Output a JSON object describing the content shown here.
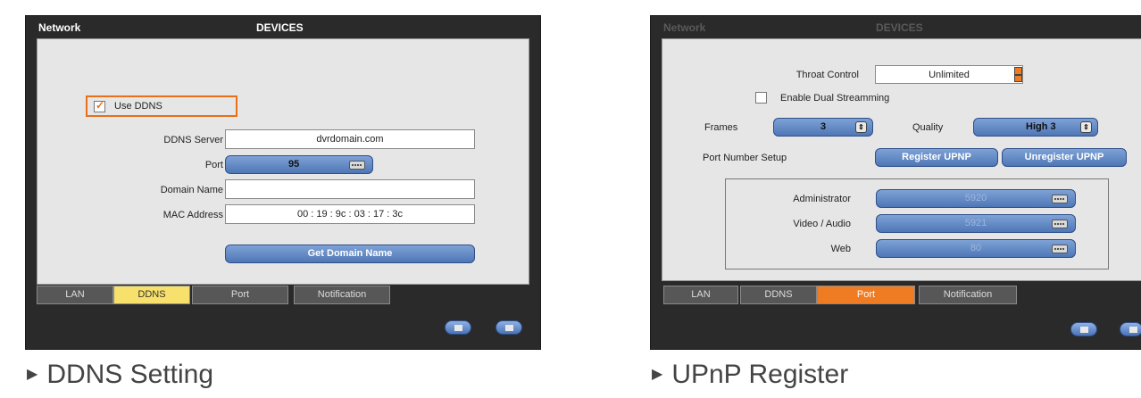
{
  "ddns_screen": {
    "menu": "Network",
    "page_title": "DEVICES",
    "use_ddns_label": "Use DDNS",
    "use_ddns_checked": true,
    "fields": {
      "server_label": "DDNS Server",
      "server_value": "dvrdomain.com",
      "port_label": "Port",
      "port_value": "95",
      "domain_label": "Domain Name",
      "domain_value": "",
      "mac_label": "MAC Address",
      "mac_value": "00 : 19 : 9c : 03 : 17 : 3c"
    },
    "get_domain_button": "Get Domain Name",
    "tabs": [
      "LAN",
      "DDNS",
      "Port",
      "Notification"
    ],
    "active_tab": "DDNS",
    "caption": "DDNS Setting"
  },
  "upnp_screen": {
    "menu": "Network",
    "page_title": "DEVICES",
    "throat_label": "Throat Control",
    "throat_value": "Unlimited",
    "dual_stream_label": "Enable Dual Streamming",
    "dual_stream_checked": false,
    "frames_label": "Frames",
    "frames_value": "3",
    "quality_label": "Quality",
    "quality_value": "High 3",
    "port_setup_label": "Port Number Setup",
    "register_button": "Register UPNP",
    "unregister_button": "Unregister UPNP",
    "ports": {
      "admin_label": "Administrator",
      "admin_value": "5920",
      "video_label": "Video / Audio",
      "video_value": "5921",
      "web_label": "Web",
      "web_value": "80"
    },
    "tabs": [
      "LAN",
      "DDNS",
      "Port",
      "Notification"
    ],
    "active_tab": "Port",
    "caption": "UPnP Register"
  },
  "colors": {
    "accent_orange": "#ef7b23",
    "accent_yellow": "#f7e06b",
    "pill_blue": "#5a82c0",
    "frame_dark": "#2a2a2a"
  },
  "icons": {
    "keyboard": "keyboard-icon",
    "stepper": "stepper-icon",
    "checkmark": "checkmark-icon",
    "arrow_up": "arrow-up-icon",
    "exit": "exit-icon",
    "caption_bullet": "triangle-right-icon"
  }
}
